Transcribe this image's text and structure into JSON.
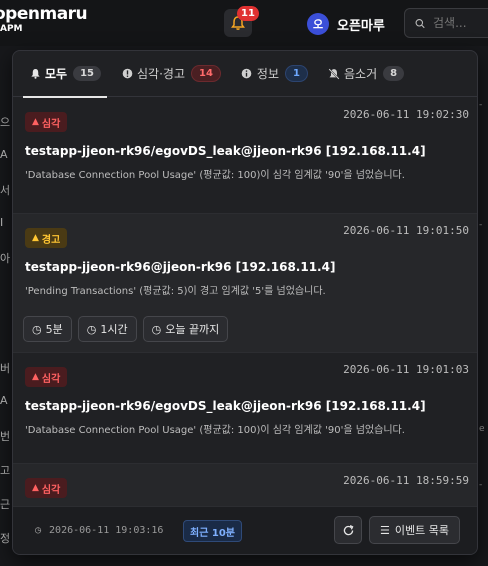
{
  "header": {
    "logo": "openmaru",
    "logo_sub": "APM",
    "notification_count": "11",
    "user_avatar": "오",
    "user_name": "오픈마루",
    "search_placeholder": "검색..."
  },
  "background": {
    "left_chars": [
      "으",
      "A",
      "서",
      "I",
      "아",
      "버",
      "A",
      "번",
      "고",
      "근",
      "정"
    ],
    "right_chars": [
      "-",
      "-",
      "e",
      "-"
    ]
  },
  "tabs": [
    {
      "label": "모두",
      "count": "15",
      "icon": "bell-icon",
      "active": true
    },
    {
      "label": "심각·경고",
      "count": "14",
      "icon": "alert-circle-icon",
      "active": false
    },
    {
      "label": "정보",
      "count": "1",
      "icon": "info-icon",
      "active": false
    },
    {
      "label": "음소거",
      "count": "8",
      "icon": "bell-off-icon",
      "active": false
    }
  ],
  "events": [
    {
      "severity": "심각",
      "timestamp": "2026-06-11 19:02:30",
      "title": "testapp-jjeon-rk96/egovDS_leak@jjeon-rk96 [192.168.11.4]",
      "message": "'Database Connection Pool Usage' (평균값: 100)이 심각 임계값 '90'을 넘었습니다."
    },
    {
      "severity": "경고",
      "timestamp": "2026-06-11 19:01:50",
      "title": "testapp-jjeon-rk96@jjeon-rk96 [192.168.11.4]",
      "message": "'Pending Transactions' (평균값: 5)이 경고 임계값 '5'를 넘었습니다.",
      "snooze": [
        "5분",
        "1시간",
        "오늘 끝까지"
      ]
    },
    {
      "severity": "심각",
      "timestamp": "2026-06-11 19:01:03",
      "title": "testapp-jjeon-rk96/egovDS_leak@jjeon-rk96 [192.168.11.4]",
      "message": "'Database Connection Pool Usage' (평균값: 100)이 심각 임계값 '90'을 넘었습니다."
    },
    {
      "severity": "심각",
      "timestamp": "2026-06-11 18:59:59",
      "title": "",
      "message": ""
    }
  ],
  "footer": {
    "time": "2026-06-11 19:03:16",
    "recent": "최근 10분",
    "list_button": "이벤트 목록"
  },
  "colors": {
    "critical": "#ff6161",
    "warning": "#ffc633",
    "info": "#6ea8ff",
    "badge": "#e03131"
  }
}
